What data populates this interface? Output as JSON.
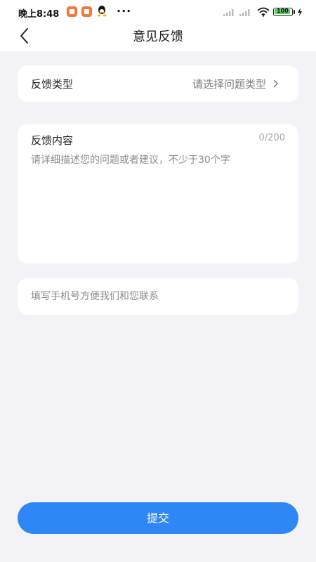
{
  "status_bar": {
    "time": "晚上8:48",
    "battery": "100",
    "app_icon_color": "#f07a3a"
  },
  "header": {
    "title": "意见反馈",
    "back_icon": "chevron-left-icon"
  },
  "feedback_type": {
    "label": "反馈类型",
    "value": "请选择问题类型",
    "chevron": ">"
  },
  "feedback_content": {
    "label": "反馈内容",
    "count": "0/200",
    "placeholder": "请详细描述您的问题或者建议，不少于30个字"
  },
  "contact": {
    "placeholder": "填写手机号方便我们和您联系"
  },
  "submit": {
    "label": "提交",
    "color": "#2e87f5"
  },
  "colors": {
    "background": "#f3f3f7",
    "card": "#ffffff",
    "accent": "#2e87f5"
  }
}
